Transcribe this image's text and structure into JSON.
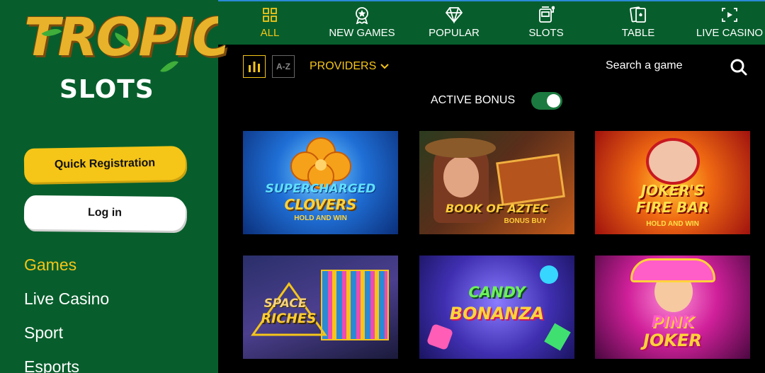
{
  "brand": {
    "logo_top": "TROPIC",
    "logo_bottom": "SLOTS"
  },
  "sidebar": {
    "register_label": "Quick Registration",
    "login_label": "Log in",
    "links": [
      {
        "label": "Games",
        "active": true
      },
      {
        "label": "Live Casino",
        "active": false
      },
      {
        "label": "Sport",
        "active": false
      },
      {
        "label": "Esports",
        "active": false
      }
    ]
  },
  "topnav": {
    "tabs": [
      {
        "label": "ALL",
        "icon": "grid-icon",
        "active": true
      },
      {
        "label": "NEW GAMES",
        "icon": "medal-icon",
        "active": false
      },
      {
        "label": "POPULAR",
        "icon": "diamond-icon",
        "active": false
      },
      {
        "label": "SLOTS",
        "icon": "slot-machine-icon",
        "active": false
      },
      {
        "label": "TABLE",
        "icon": "cards-icon",
        "active": false
      },
      {
        "label": "LIVE CASINO",
        "icon": "live-screen-icon",
        "active": false
      }
    ]
  },
  "filters": {
    "sort_az_label": "A-Z",
    "providers_label": "PROVIDERS",
    "search_placeholder": "Search a game",
    "active_bonus_label": "ACTIVE BONUS",
    "active_bonus_on": true
  },
  "games": [
    {
      "line1": "SUPERCHARGED",
      "line2": "CLOVERS",
      "sub": "HOLD AND WIN"
    },
    {
      "line1": "BOOK OF AZTEC",
      "line2": "",
      "sub": "BONUS BUY"
    },
    {
      "line1": "JOKER'S",
      "line2": "FIRE BAR",
      "sub": "HOLD AND WIN"
    },
    {
      "line1": "SPACE",
      "line2": "RICHES",
      "sub": ""
    },
    {
      "line1": "CANDY",
      "line2": "BONANZA",
      "sub": ""
    },
    {
      "line1": "PINK",
      "line2": "JOKER",
      "sub": ""
    }
  ],
  "colors": {
    "green": "#075e2c",
    "accent": "#f5c518",
    "black": "#000000"
  }
}
